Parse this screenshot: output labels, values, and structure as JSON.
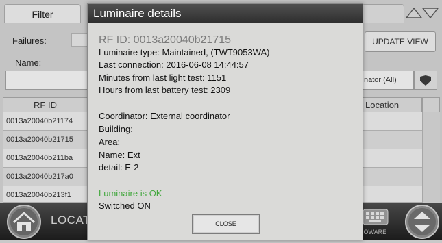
{
  "background": {
    "filter_tab": "Filter",
    "failures_label": "Failures:",
    "name_label": "Name:",
    "update_view_label": "UPDATE VIEW",
    "coordinator_filter": "nator (All)",
    "table": {
      "col_rfid": "RF ID",
      "col_location": "Location",
      "rows": [
        "0013a20040b21174",
        "0013a20040b21715",
        "0013a20040b211ba",
        "0013a20040b217a0",
        "0013a20040b213f1"
      ]
    },
    "bottom": {
      "location_button_text": "LOCAT",
      "brand_partial": "IOWARE"
    }
  },
  "modal": {
    "title": "Luminaire details",
    "rf_id": "RF ID:  0013a20040b21715",
    "type": "Luminaire type:  Maintained, (TWT9053WA)",
    "last_connection": "Last connection:  2016-06-08 14:44:57",
    "minutes_light_test": "Minutes from last light test:  1151",
    "hours_battery_test": "Hours from last battery test:  2309",
    "coordinator": "Coordinator:  External coordinator",
    "building": "Building:",
    "area": "Area:",
    "name": "Name:  Ext",
    "detail": "detail:  E-2",
    "status_ok": "Luminaire is OK",
    "switched": "Switched ON",
    "close_label": "CLOSE"
  },
  "colors": {
    "status_ok": "#44a83f",
    "header_bar": "#3a3a3a",
    "bottom_bar": "#2b2b2b"
  },
  "icons": [
    "home-icon",
    "up-down-arrows-icon",
    "chevron-down-icon",
    "keyboard-icon",
    "up-down-nav-icon"
  ]
}
